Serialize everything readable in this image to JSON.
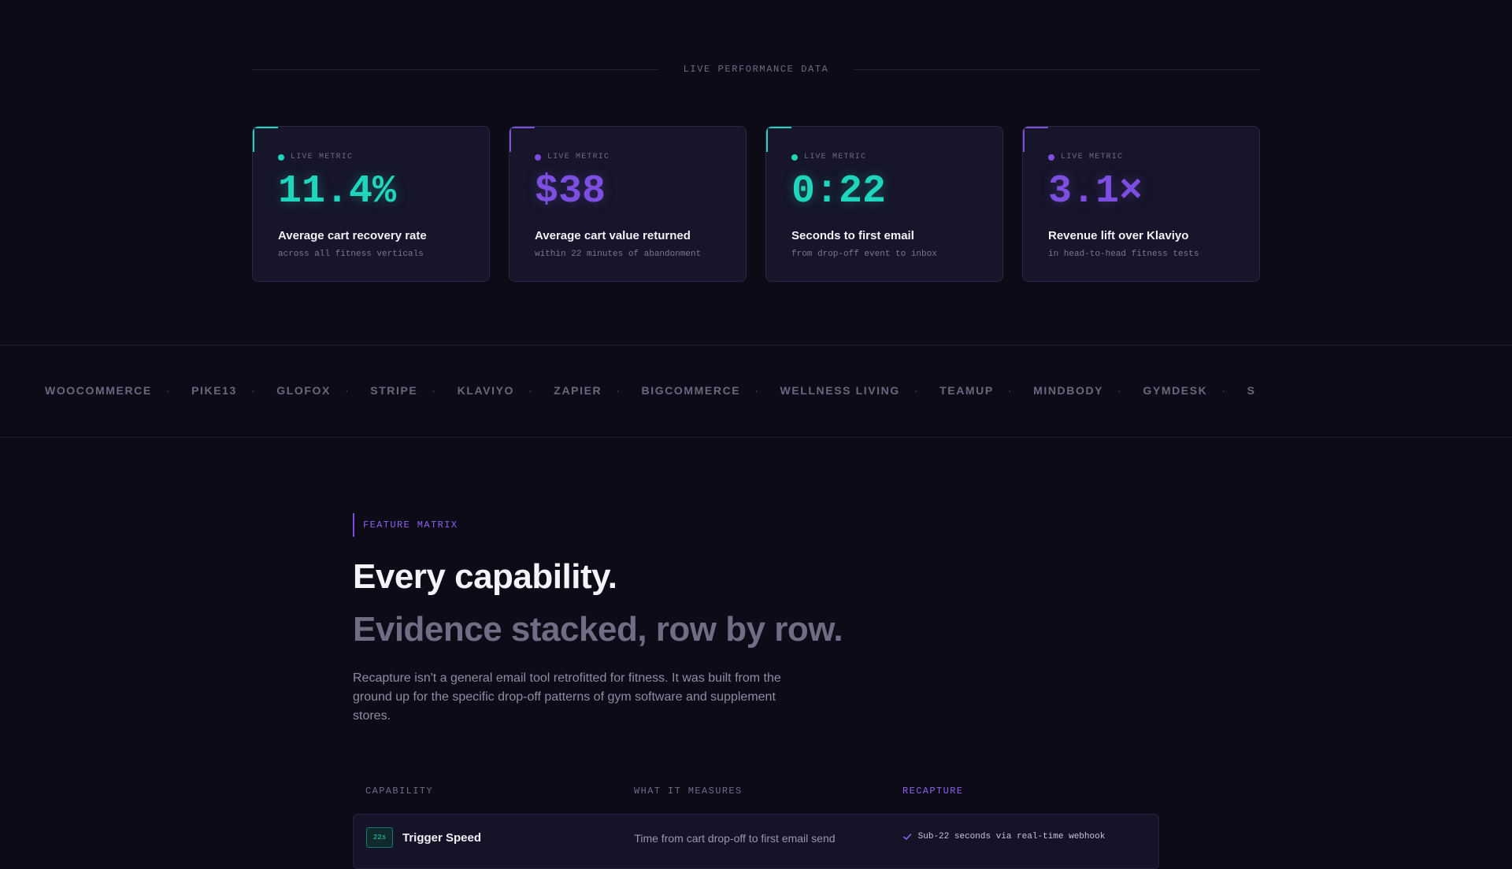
{
  "performance": {
    "label": "LIVE PERFORMANCE DATA",
    "cards": [
      {
        "live_label": "LIVE METRIC",
        "value": "11.4%",
        "title": "Average cart recovery rate",
        "subtitle": "across all fitness verticals",
        "accent": "#1fd6bd"
      },
      {
        "live_label": "LIVE METRIC",
        "value": "$38",
        "title": "Average cart value returned",
        "subtitle": "within 22 minutes of abandonment",
        "accent": "#7c4fe0"
      },
      {
        "live_label": "LIVE METRIC",
        "value": "0:22",
        "title": "Seconds to first email",
        "subtitle": "from drop-off event to inbox",
        "accent": "#1fd6bd"
      },
      {
        "live_label": "LIVE METRIC",
        "value": "3.1×",
        "title": "Revenue lift over Klaviyo",
        "subtitle": "in head-to-head fitness tests",
        "accent": "#7c4fe0"
      }
    ]
  },
  "integrations": {
    "separator": "·",
    "items": [
      "WOOCOMMERCE",
      "PIKE13",
      "GLOFOX",
      "STRIPE",
      "KLAVIYO",
      "ZAPIER",
      "BIGCOMMERCE",
      "WELLNESS LIVING",
      "TEAMUP",
      "MINDBODY",
      "GYMDESK",
      "S"
    ]
  },
  "feature_matrix": {
    "tag": "FEATURE MATRIX",
    "heading_line1": "Every capability.",
    "heading_line2": "Evidence stacked, row by row.",
    "description": "Recapture isn't a general email tool retrofitted for fitness. It was built from the ground up for the specific drop-off patterns of gym software and supplement stores.",
    "columns": [
      "CAPABILITY",
      "WHAT IT MEASURES",
      "RECAPTURE"
    ],
    "rows": [
      {
        "badge": "22s",
        "capability": "Trigger Speed",
        "measures": "Time from cart drop-off to first email send",
        "recapture": "Sub-22 seconds via real-time webhook"
      }
    ]
  },
  "colors": {
    "teal": "#1fd6bd",
    "purple": "#7c4fe0",
    "background": "#0c0b17",
    "card": "#161529"
  }
}
